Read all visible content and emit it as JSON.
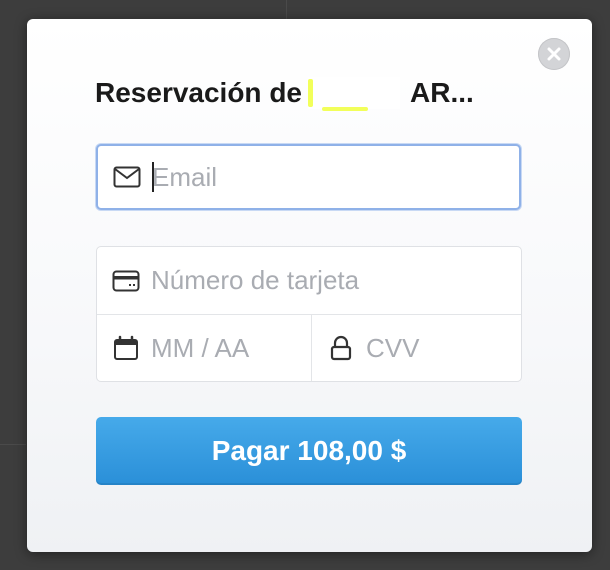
{
  "modal": {
    "title_prefix": "Reservación de",
    "title_suffix": "AR..."
  },
  "form": {
    "email_placeholder": "Email",
    "card_number_placeholder": "Número de tarjeta",
    "expiry_placeholder": "MM / AA",
    "cvv_placeholder": "CVV"
  },
  "pay_button": {
    "label": "Pagar 108,00 $",
    "color": "#3a9fe4"
  },
  "icons": {
    "close": "close-icon",
    "email": "envelope-icon",
    "card": "credit-card-icon",
    "expiry": "calendar-icon",
    "cvv": "lock-icon"
  }
}
